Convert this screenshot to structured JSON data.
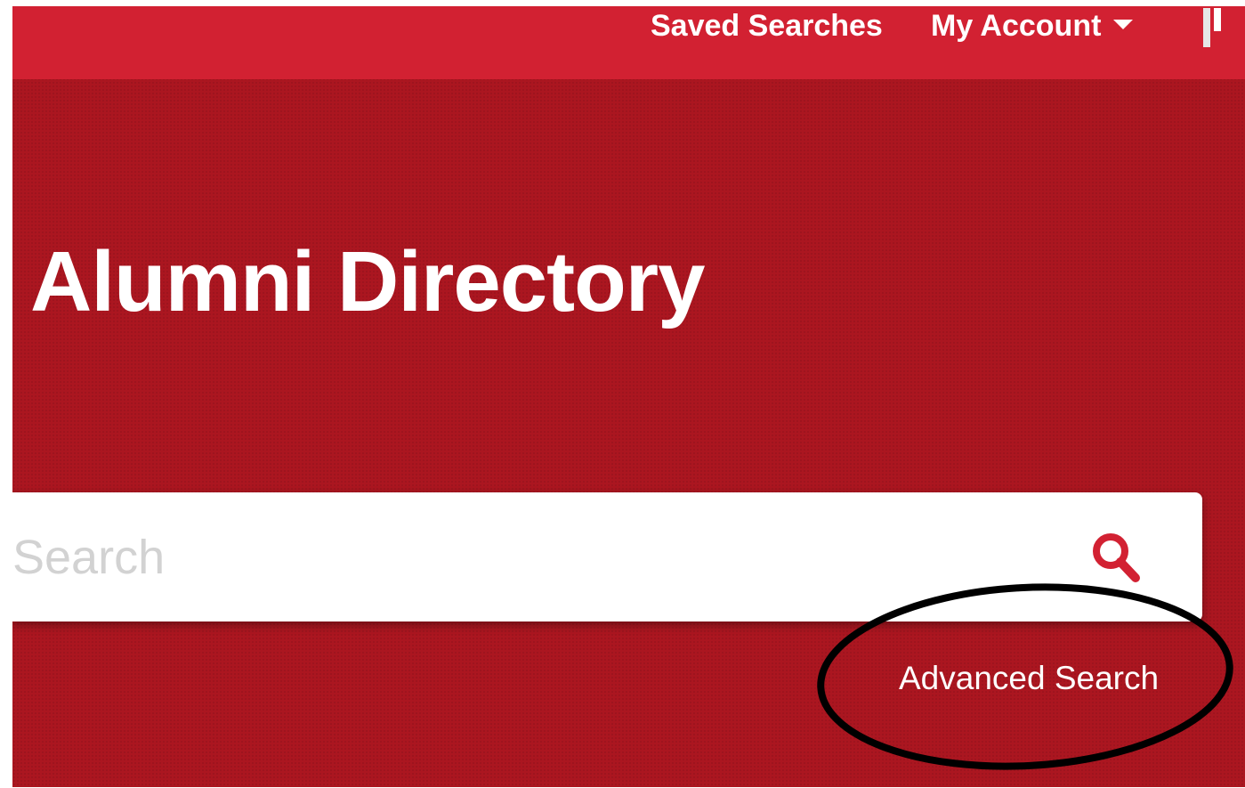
{
  "header": {
    "nav": {
      "saved_searches": "Saved Searches",
      "my_account": "My Account"
    }
  },
  "hero": {
    "title": "Alumni Directory"
  },
  "search": {
    "placeholder": "Search",
    "button_icon": "search-icon",
    "advanced_link": "Advanced Search"
  },
  "colors": {
    "topbar": "#d22132",
    "hero_background": "#ab1620",
    "accent_icon": "#d22132",
    "text": "#ffffff",
    "placeholder": "#d2d2d2",
    "annotation": "#000000"
  }
}
